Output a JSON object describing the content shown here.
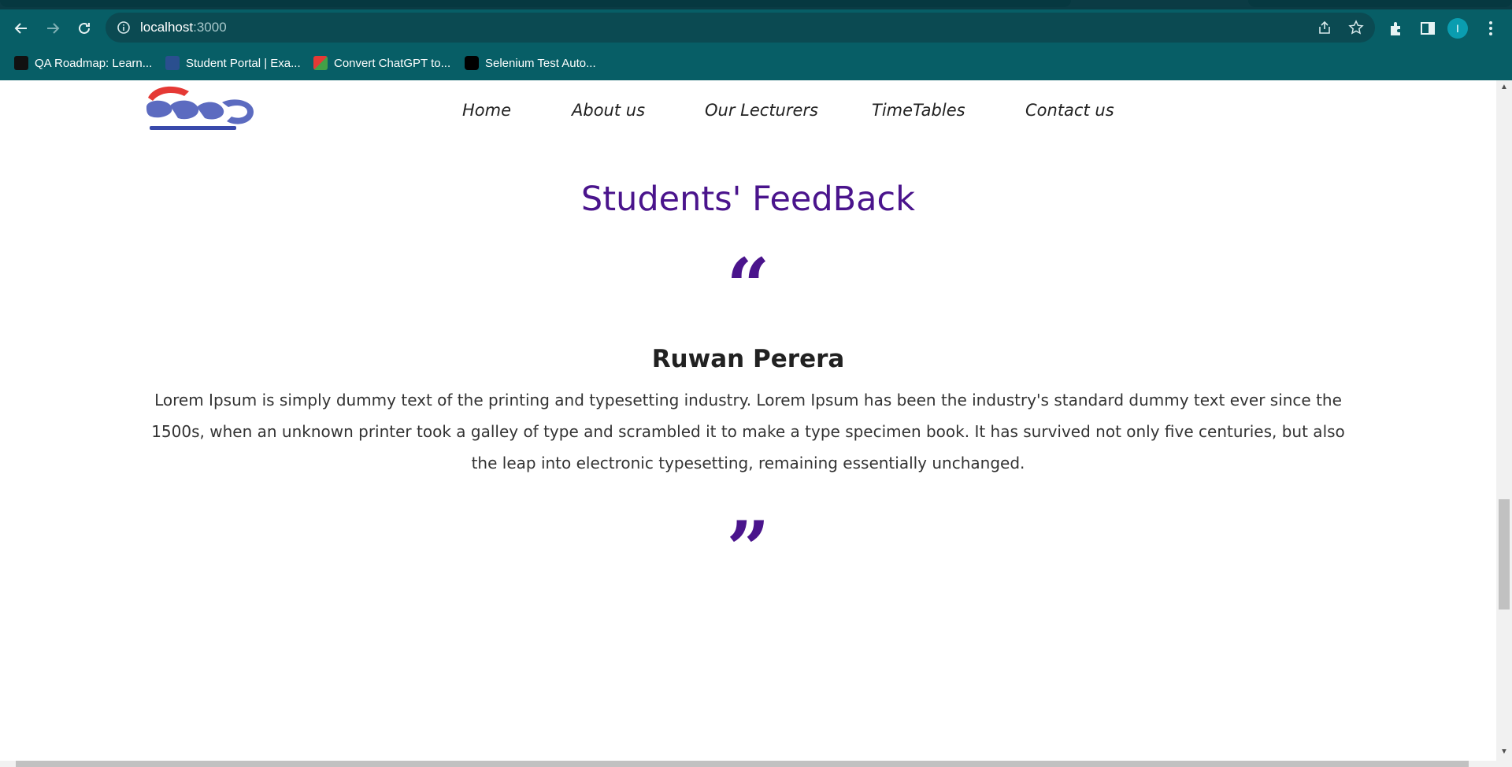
{
  "browser": {
    "url_host": "localhost",
    "url_port": ":3000",
    "profile_initial": "I",
    "bookmarks": [
      {
        "label": "QA Roadmap: Learn...",
        "icon": "roadmap-favicon"
      },
      {
        "label": "Student Portal | Exa...",
        "icon": "student-portal-favicon"
      },
      {
        "label": "Convert ChatGPT to...",
        "icon": "chatgpt-convert-favicon"
      },
      {
        "label": "Selenium Test Auto...",
        "icon": "medium-favicon"
      }
    ]
  },
  "site": {
    "logo_alt": "Siyathra logo",
    "nav": [
      {
        "label": "Home"
      },
      {
        "label": "About us"
      },
      {
        "label": "Our Lecturers"
      },
      {
        "label": "TimeTables"
      },
      {
        "label": "Contact us"
      }
    ]
  },
  "feedback": {
    "title": "Students' FeedBack",
    "open_quote": "“",
    "close_quote": "”",
    "name": "Ruwan Perera",
    "text": "Lorem Ipsum is simply dummy text of the printing and typesetting industry. Lorem Ipsum has been the industry's standard dummy text ever since the 1500s, when an unknown printer took a galley of type and scrambled it to make a type specimen book. It has survived not only five centuries, but also the leap into electronic typesetting, remaining essentially unchanged."
  },
  "colors": {
    "accent": "#4a148c",
    "chrome": "#075e66"
  }
}
